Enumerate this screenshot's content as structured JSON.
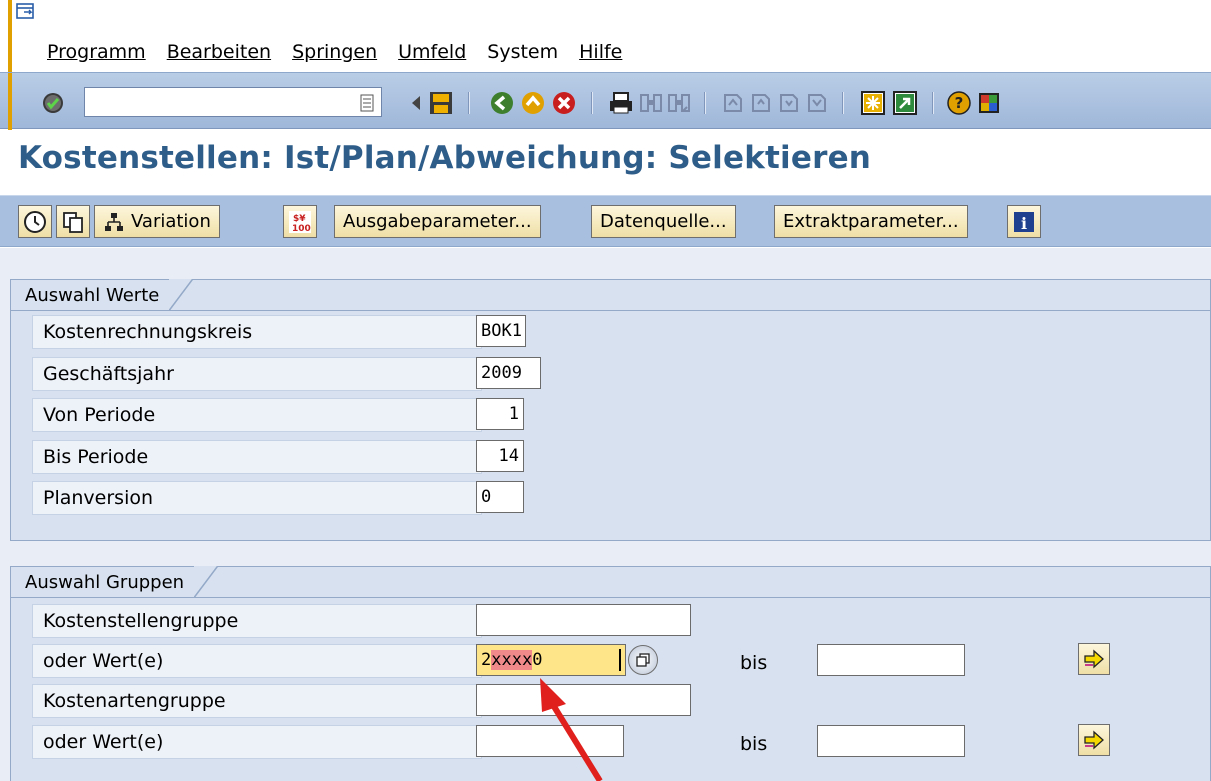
{
  "menu": {
    "items": [
      {
        "label": "Programm"
      },
      {
        "label": "Bearbeiten"
      },
      {
        "label": "Springen"
      },
      {
        "label": "Umfeld"
      },
      {
        "label": "System"
      },
      {
        "label": "Hilfe"
      }
    ]
  },
  "system_toolbar": {
    "command_field_value": ""
  },
  "page": {
    "title": "Kostenstellen: Ist/Plan/Abweichung: Selektieren"
  },
  "app_toolbar": {
    "variation_label": "Variation",
    "output_params_label": "Ausgabeparameter...",
    "data_source_label": "Datenquelle...",
    "extract_params_label": "Extraktparameter..."
  },
  "group_values": {
    "title": "Auswahl Werte",
    "rows": [
      {
        "label": "Kostenrechnungskreis",
        "value": "BOK1"
      },
      {
        "label": "Geschäftsjahr",
        "value": "2009"
      },
      {
        "label": "Von Periode",
        "value": "1"
      },
      {
        "label": "Bis Periode",
        "value": "14"
      },
      {
        "label": "Planversion",
        "value": "0"
      }
    ]
  },
  "group_groups": {
    "title": "Auswahl Gruppen",
    "cost_center_group_label": "Kostenstellengruppe",
    "cost_center_group_value": "",
    "cost_center_value_label": "oder Wert(e)",
    "cost_center_value_highlight": "xxxx",
    "cost_center_value_prefix": "2",
    "cost_center_value_suffix": "0",
    "cost_center_to_label": "bis",
    "cost_center_to_value": "",
    "cost_element_group_label": "Kostenartengruppe",
    "cost_element_group_value": "",
    "cost_element_value_label": "oder Wert(e)",
    "cost_element_value": "",
    "cost_element_to_label": "bis",
    "cost_element_to_value": ""
  },
  "colors": {
    "title": "#2e5d89",
    "active_field": "#ffe58a",
    "highlight": "#f08a8a",
    "annotation_arrow": "#e0201c"
  }
}
